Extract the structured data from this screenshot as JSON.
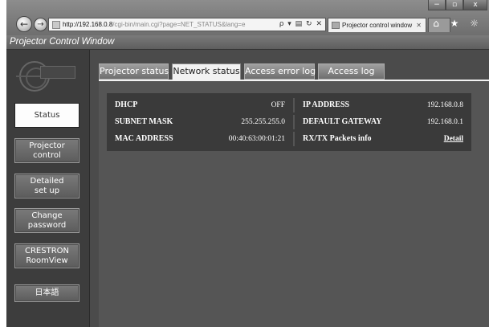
{
  "browser": {
    "address_host": "http://192.168.0.8",
    "address_path": "/cgi-bin/main.cgi?page=NET_STATUS&lang=e",
    "address_tools": "ρ ▾ ▤ ↻ ✕",
    "tab_title": "Projector control window",
    "tab_close": "✕",
    "window_controls": [
      "−",
      "▫",
      "x"
    ],
    "toolbar_icons": "⌂ ★ ☼"
  },
  "app": {
    "title": "Projector Control Window"
  },
  "sidebar": {
    "items": [
      {
        "label": "Status",
        "active": true
      },
      {
        "label": "Projector\ncontrol",
        "active": false
      },
      {
        "label": "Detailed\nset up",
        "active": false
      },
      {
        "label": "Change\npassword",
        "active": false
      },
      {
        "label": "CRESTRON\nRoomView",
        "active": false
      },
      {
        "label": "日本語",
        "active": false
      }
    ]
  },
  "tabs": [
    {
      "label": "Projector status",
      "active": false
    },
    {
      "label": "Network status",
      "active": true
    },
    {
      "label": "Access error log",
      "active": false
    },
    {
      "label": "Access log",
      "active": false
    }
  ],
  "network_status": {
    "dhcp_label": "DHCP",
    "dhcp_value": "OFF",
    "ip_label": "IP ADDRESS",
    "ip_value": "192.168.0.8",
    "subnet_label": "SUBNET MASK",
    "subnet_value": "255.255.255.0",
    "gateway_label": "DEFAULT GATEWAY",
    "gateway_value": "192.168.0.1",
    "mac_label": "MAC ADDRESS",
    "mac_value": "00:40:63:00:01:21",
    "packets_label": "RX/TX Packets info",
    "packets_link": "Detail"
  }
}
